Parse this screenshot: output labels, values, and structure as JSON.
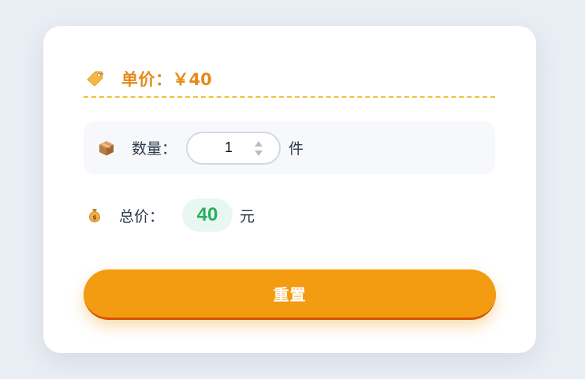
{
  "price": {
    "icon": "price-tag-icon",
    "label": "单价：",
    "value": "￥40"
  },
  "quantity": {
    "icon": "package-icon",
    "label": "数量：",
    "value": "1",
    "unit": "件"
  },
  "total": {
    "icon": "money-bag-icon",
    "label": "总价：",
    "value": "40",
    "unit": "元"
  },
  "reset_button": {
    "label": "重置"
  },
  "colors": {
    "accent": "#e68a1a",
    "button": "#f39c12",
    "total_text": "#27ae60",
    "total_bg": "#e8f8f1",
    "dashed_line": "#f1c232"
  }
}
